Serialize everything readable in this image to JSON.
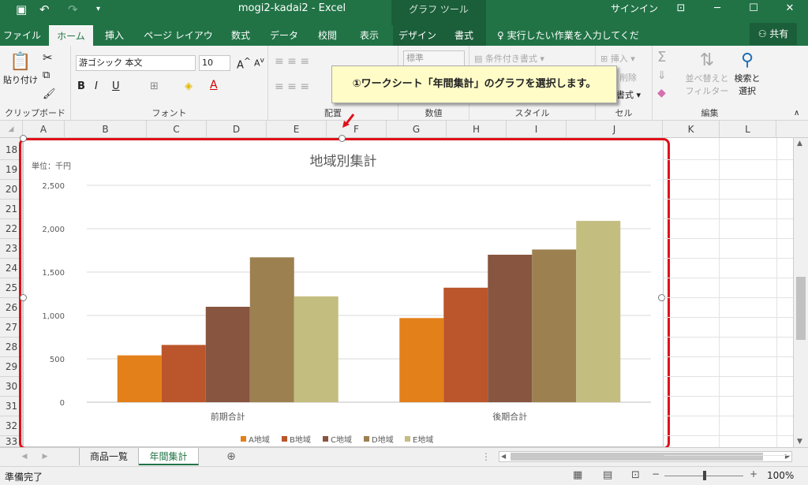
{
  "app": {
    "doc_title": "mogi2-kadai2  -  Excel",
    "context_tool": "グラフ ツール",
    "signin": "サインイン",
    "share": "共有"
  },
  "tabs": [
    "ファイル",
    "ホーム",
    "挿入",
    "ページ レイアウト",
    "数式",
    "データ",
    "校閲",
    "表示",
    "デザイン",
    "書式"
  ],
  "tell_me": "実行したい作業を入力してください",
  "ribbon": {
    "clipboard": {
      "paste": "貼り付け",
      "label": "クリップボード"
    },
    "font": {
      "name": "游ゴシック 本文",
      "size": "10",
      "label": "フォント"
    },
    "align": {
      "label": "配置"
    },
    "number": {
      "format": "標準",
      "label": "数値"
    },
    "styles": {
      "cond": "条件付き書式",
      "label": "スタイル"
    },
    "cells": {
      "insert": "挿入",
      "delete": "削除",
      "format": "書式",
      "label": "セル"
    },
    "edit": {
      "sort1": "並べ替えと",
      "sort2": "フィルター",
      "find1": "検索と",
      "find2": "選択",
      "label": "編集"
    }
  },
  "callout": "①ワークシート「年間集計」のグラフを選択します。",
  "columns": [
    "A",
    "B",
    "C",
    "D",
    "E",
    "F",
    "G",
    "H",
    "I",
    "J",
    "K",
    "L"
  ],
  "rows": [
    "18",
    "19",
    "20",
    "21",
    "22",
    "23",
    "24",
    "25",
    "26",
    "27",
    "28",
    "29",
    "30",
    "31",
    "32",
    "33"
  ],
  "sheets": {
    "tab1": "商品一覧",
    "tab2": "年間集計"
  },
  "status": {
    "ready": "準備完了",
    "zoom": "100%"
  },
  "colors": {
    "excel_green": "#217346",
    "highlight_red": "#e0101a"
  },
  "chart_data": {
    "type": "bar",
    "title": "地域別集計",
    "unit_label": "単位：千円",
    "categories": [
      "前期合計",
      "後期合計"
    ],
    "series": [
      {
        "name": "A地域",
        "color": "#e3801a",
        "values": [
          540,
          970
        ]
      },
      {
        "name": "B地域",
        "color": "#bb552b",
        "values": [
          660,
          1320
        ]
      },
      {
        "name": "C地域",
        "color": "#875540",
        "values": [
          1100,
          1700
        ]
      },
      {
        "name": "D地域",
        "color": "#9c8050",
        "values": [
          1670,
          1760
        ]
      },
      {
        "name": "E地域",
        "color": "#c4bd80",
        "values": [
          1220,
          2090
        ]
      }
    ],
    "ylim": [
      0,
      2500
    ],
    "yticks": [
      "0",
      "500",
      "1,000",
      "1,500",
      "2,000",
      "2,500"
    ],
    "grid": true,
    "legend": "bottom"
  }
}
